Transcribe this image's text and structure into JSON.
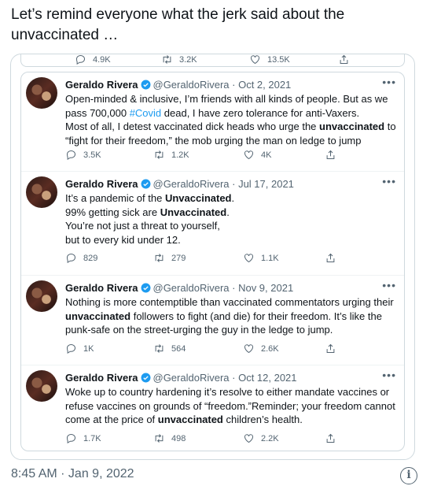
{
  "caption": "Let’s remind everyone what the jerk said about the unvaccinated …",
  "quoted_top_stats": {
    "replies": "4.9K",
    "retweets": "3.2K",
    "likes": "13.5K"
  },
  "tweets": [
    {
      "name": "Geraldo Rivera",
      "handle": "@GeraldoRivera",
      "date": "Oct 2, 2021",
      "lines": [
        [
          {
            "t": "Open-minded & inclusive, I’m friends with all kinds of people. But as we"
          }
        ],
        [
          {
            "t": "pass 700,000 "
          },
          {
            "t": "#Covid",
            "s": "hash"
          },
          {
            "t": " dead, I have zero tolerance for anti-Vaxers."
          }
        ],
        [
          {
            "t": "Most of all, I detest vaccinated dick heads who urge the "
          },
          {
            "t": "unvaccinated",
            "s": "b"
          },
          {
            "t": " to"
          }
        ],
        [
          {
            "t": "“fight for their freedom,” the mob urging the man on ledge to jump"
          }
        ]
      ],
      "replies": "3.5K",
      "retweets": "1.2K",
      "likes": "4K"
    },
    {
      "name": "Geraldo Rivera",
      "handle": "@GeraldoRivera",
      "date": "Jul 17, 2021",
      "lines": [
        [
          {
            "t": "It’s a pandemic of the "
          },
          {
            "t": "Unvaccinated",
            "s": "b"
          },
          {
            "t": "."
          }
        ],
        [
          {
            "t": "99% getting sick are "
          },
          {
            "t": "Unvaccinated",
            "s": "b"
          },
          {
            "t": "."
          }
        ],
        [
          {
            "t": "You’re not just a threat to yourself,"
          }
        ],
        [
          {
            "t": "but to every kid under 12."
          }
        ]
      ],
      "replies": "829",
      "retweets": "279",
      "likes": "1.1K"
    },
    {
      "name": "Geraldo Rivera",
      "handle": "@GeraldoRivera",
      "date": "Nov 9, 2021",
      "lines": [
        [
          {
            "t": "Nothing is more contemptible than vaccinated commentators urging their"
          }
        ],
        [
          {
            "t": "unvaccinated",
            "s": "b"
          },
          {
            "t": " followers to fight (and die) for their freedom. It’s like the"
          }
        ],
        [
          {
            "t": "punk-safe on the street-urging the guy in the ledge to jump."
          }
        ]
      ],
      "replies": "1K",
      "retweets": "564",
      "likes": "2.6K"
    },
    {
      "name": "Geraldo Rivera",
      "handle": "@GeraldoRivera",
      "date": "Oct 12, 2021",
      "lines": [
        [
          {
            "t": "Woke up to country hardening it’s resolve to either mandate vaccines or"
          }
        ],
        [
          {
            "t": "refuse vaccines on grounds of “freedom.”Reminder; your freedom cannot"
          }
        ],
        [
          {
            "t": "come at the price of "
          },
          {
            "t": "unvaccinated",
            "s": "b"
          },
          {
            "t": " children’s health."
          }
        ]
      ],
      "replies": "1.7K",
      "retweets": "498",
      "likes": "2.2K"
    }
  ],
  "footer": {
    "timestamp": "8:45 AM · Jan 9, 2022"
  },
  "colors": {
    "link": "#1d9bf0",
    "muted": "#536471",
    "border": "#cfd9de",
    "verified": "#1d9bf0"
  },
  "icons": [
    "reply-icon",
    "retweet-icon",
    "like-icon",
    "share-icon",
    "verified-badge-icon",
    "more-icon",
    "info-icon"
  ]
}
